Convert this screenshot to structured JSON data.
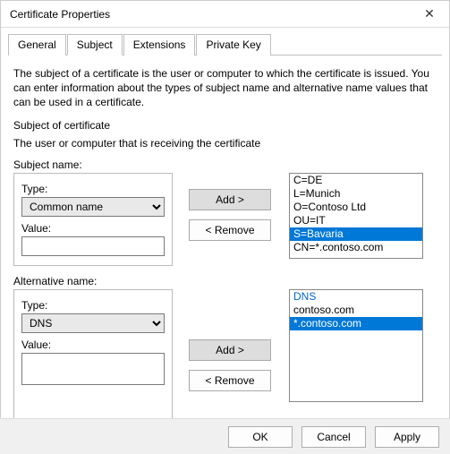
{
  "window": {
    "title": "Certificate Properties",
    "close_icon": "✕"
  },
  "tabs": {
    "general": "General",
    "subject": "Subject",
    "extensions": "Extensions",
    "private_key": "Private Key"
  },
  "description": "The subject of a certificate is the user or computer to which the certificate is issued. You can enter information about the types of subject name and alternative name values that can be used in a certificate.",
  "subject_of_cert_label": "Subject of certificate",
  "subject_receiving_label": "The user or computer that is receiving the certificate",
  "subject_name": {
    "heading": "Subject name:",
    "type_label": "Type:",
    "type_value": "Common name",
    "value_label": "Value:",
    "value_value": "",
    "add_btn": "Add >",
    "remove_btn": "< Remove",
    "list": {
      "items": [
        "C=DE",
        "L=Munich",
        "O=Contoso Ltd",
        "OU=IT",
        "S=Bavaria",
        "CN=*.contoso.com"
      ],
      "selected_index": 4
    }
  },
  "alt_name": {
    "heading": "Alternative name:",
    "type_label": "Type:",
    "type_value": "DNS",
    "value_label": "Value:",
    "value_value": "",
    "add_btn": "Add >",
    "remove_btn": "< Remove",
    "list": {
      "header": "DNS",
      "items": [
        "contoso.com",
        "*.contoso.com"
      ],
      "selected_index": 1
    }
  },
  "footer": {
    "ok": "OK",
    "cancel": "Cancel",
    "apply": "Apply"
  }
}
